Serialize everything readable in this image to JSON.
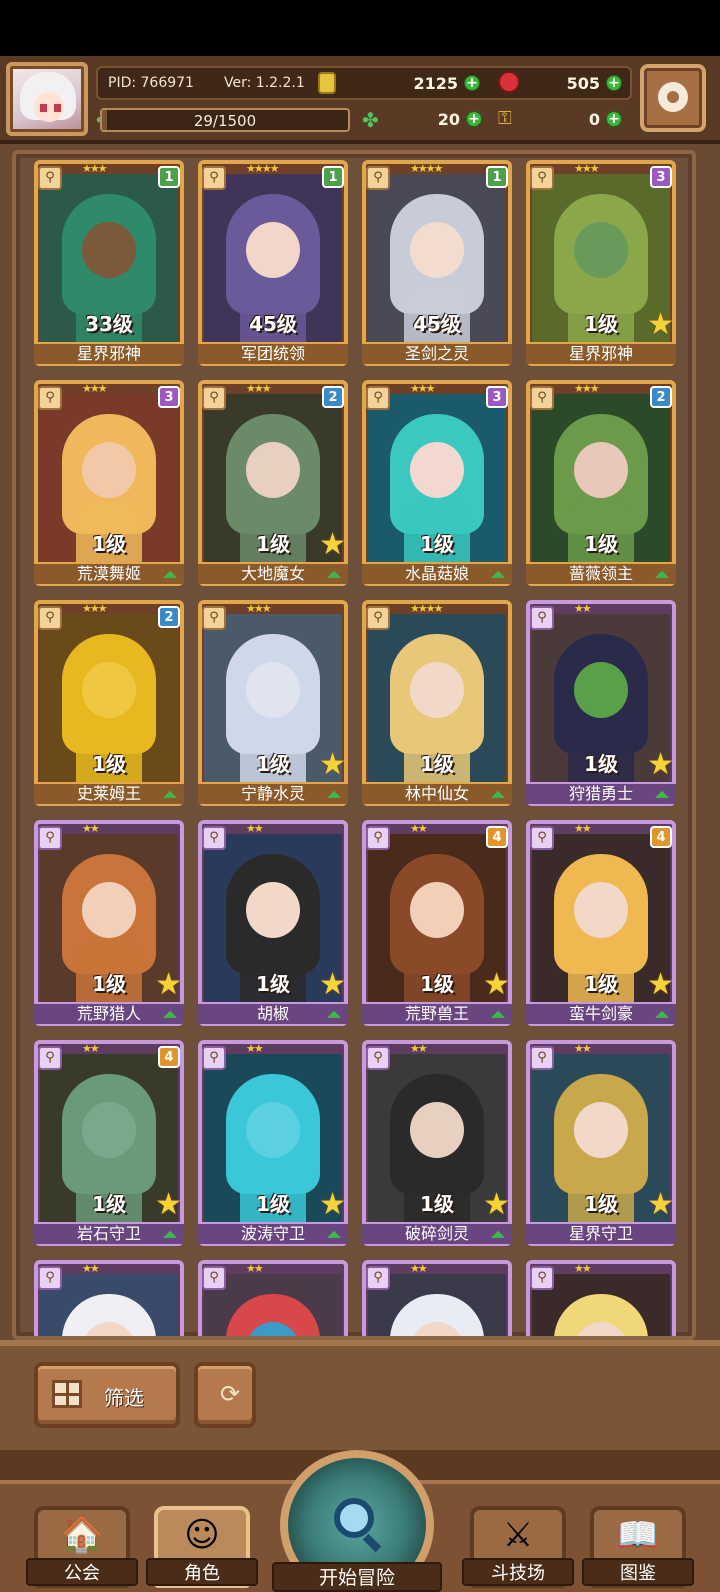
{
  "header": {
    "pid": "PID: 766971",
    "version": "Ver: 1.2.2.1",
    "gold": "2125",
    "gems": "505",
    "exp_text": "29/1500",
    "exp_fraction": 0.0193,
    "clover": "20",
    "keys": "0"
  },
  "cards": [
    {
      "name": "星界邪神",
      "level": "33级",
      "stars": "★★★",
      "badge": "1",
      "badge_color": "#4ca04a",
      "frame": "gold",
      "bg": "#2c5a4a",
      "hue": "#2f8a6a",
      "skin": "#7a5a3a",
      "tag_star": false
    },
    {
      "name": "军团统领",
      "level": "45级",
      "stars": "★★★★",
      "badge": "1",
      "badge_color": "#4ca04a",
      "frame": "gold",
      "bg": "#403458",
      "hue": "#6a5a9a",
      "skin": "#f2d6ca",
      "tag_star": false
    },
    {
      "name": "圣剑之灵",
      "level": "45级",
      "stars": "★★★★",
      "badge": "1",
      "badge_color": "#4ca04a",
      "frame": "gold",
      "bg": "#4a4a56",
      "hue": "#c8ccd8",
      "skin": "#f2dccf",
      "tag_star": false
    },
    {
      "name": "星界邪神",
      "level": "1级",
      "stars": "★★★",
      "badge": "3",
      "badge_color": "#9a5ac2",
      "frame": "gold",
      "bg": "#5a6a2a",
      "hue": "#8aa84a",
      "skin": "#6a9a5a",
      "tag_star": true
    },
    {
      "name": "荒漠舞姬",
      "level": "1级",
      "stars": "★★★",
      "badge": "3",
      "badge_color": "#9a5ac2",
      "frame": "gold",
      "bg": "#7a3a2a",
      "hue": "#f0b85a",
      "skin": "#f2c8a8",
      "tag_star": false,
      "up": true
    },
    {
      "name": "大地魔女",
      "level": "1级",
      "stars": "★★★",
      "badge": "2",
      "badge_color": "#3a8ac8",
      "frame": "gold",
      "bg": "#3a3a2a",
      "hue": "#6a8a6a",
      "skin": "#e8d0c0",
      "tag_star": true,
      "up": true
    },
    {
      "name": "水晶菇娘",
      "level": "1级",
      "stars": "★★★",
      "badge": "3",
      "badge_color": "#9a5ac2",
      "frame": "gold",
      "bg": "#1a5a6a",
      "hue": "#3ac8c0",
      "skin": "#f2d8cf",
      "tag_star": false,
      "up": true
    },
    {
      "name": "蔷薇领主",
      "level": "1级",
      "stars": "★★★",
      "badge": "2",
      "badge_color": "#3a8ac8",
      "frame": "gold",
      "bg": "#2a4a2a",
      "hue": "#6a9a4a",
      "skin": "#e8c8b8",
      "tag_star": false,
      "up": true
    },
    {
      "name": "史莱姆王",
      "level": "1级",
      "stars": "★★★",
      "badge": "2",
      "badge_color": "#3a8ac8",
      "frame": "gold",
      "bg": "#6a4a1a",
      "hue": "#e8b820",
      "skin": "#f0c840",
      "tag_star": false,
      "up": true
    },
    {
      "name": "宁静水灵",
      "level": "1级",
      "stars": "★★★",
      "badge": "",
      "badge_color": "",
      "frame": "gold",
      "bg": "#4a5a6a",
      "hue": "#cfd8e8",
      "skin": "#dfe4ef",
      "tag_star": true,
      "up": true
    },
    {
      "name": "林中仙女",
      "level": "1级",
      "stars": "★★★★",
      "badge": "",
      "badge_color": "",
      "frame": "gold",
      "bg": "#2a4a5a",
      "hue": "#e8c878",
      "skin": "#f2d8c8",
      "tag_star": false,
      "up": true
    },
    {
      "name": "狩猎勇士",
      "level": "1级",
      "stars": "★★",
      "badge": "",
      "badge_color": "",
      "frame": "purple",
      "bg": "#4a3a3a",
      "hue": "#2a2a4a",
      "skin": "#5aa048",
      "tag_star": true,
      "up": true
    },
    {
      "name": "荒野猎人",
      "level": "1级",
      "stars": "★★",
      "badge": "",
      "badge_color": "",
      "frame": "purple",
      "bg": "#5a3a2a",
      "hue": "#c8743a",
      "skin": "#f2d0b8",
      "tag_star": true,
      "up": true
    },
    {
      "name": "胡椒",
      "level": "1级",
      "stars": "★★",
      "badge": "",
      "badge_color": "",
      "frame": "purple",
      "bg": "#2a3a5a",
      "hue": "#2a2a2a",
      "skin": "#f2d8c8",
      "tag_star": true,
      "up": true
    },
    {
      "name": "荒野兽王",
      "level": "1级",
      "stars": "★★",
      "badge": "4",
      "badge_color": "#e0962a",
      "frame": "purple",
      "bg": "#4a2a1a",
      "hue": "#8a4a2a",
      "skin": "#f2d0b8",
      "tag_star": true,
      "up": true
    },
    {
      "name": "蛮牛剑豪",
      "level": "1级",
      "stars": "★★",
      "badge": "4",
      "badge_color": "#e0962a",
      "frame": "purple",
      "bg": "#3a2a2a",
      "hue": "#f0b850",
      "skin": "#f2d8c8",
      "tag_star": true,
      "up": true
    },
    {
      "name": "岩石守卫",
      "level": "1级",
      "stars": "★★",
      "badge": "4",
      "badge_color": "#e0962a",
      "frame": "purple",
      "bg": "#3a3a2a",
      "hue": "#6a9a7a",
      "skin": "#7aa88a",
      "tag_star": true,
      "up": true
    },
    {
      "name": "波涛守卫",
      "level": "1级",
      "stars": "★★",
      "badge": "",
      "badge_color": "",
      "frame": "purple",
      "bg": "#1a4a5a",
      "hue": "#3ac8d8",
      "skin": "#5ad0e0",
      "tag_star": true,
      "up": true
    },
    {
      "name": "破碎剑灵",
      "level": "1级",
      "stars": "★★",
      "badge": "",
      "badge_color": "",
      "frame": "purple",
      "bg": "#3a3a3a",
      "hue": "#2a2a2a",
      "skin": "#e8d0c0",
      "tag_star": true,
      "up": true
    },
    {
      "name": "星界守卫",
      "level": "1级",
      "stars": "★★",
      "badge": "",
      "badge_color": "",
      "frame": "purple",
      "bg": "#2a4a5a",
      "hue": "#c8a84a",
      "skin": "#f2d8c8",
      "tag_star": true,
      "up": false
    },
    {
      "name": "",
      "level": "",
      "stars": "★★",
      "badge": "",
      "badge_color": "",
      "frame": "purple",
      "bg": "#3a4a6a",
      "hue": "#f0f0f4",
      "skin": "#f2d8c8",
      "tag_star": false
    },
    {
      "name": "",
      "level": "",
      "stars": "★★",
      "badge": "",
      "badge_color": "",
      "frame": "purple",
      "bg": "#4a3a4a",
      "hue": "#d8484a",
      "skin": "#3a9ac8",
      "tag_star": false
    },
    {
      "name": "",
      "level": "",
      "stars": "★★",
      "badge": "",
      "badge_color": "",
      "frame": "purple",
      "bg": "#3a3a4a",
      "hue": "#e8ecf4",
      "skin": "#f2d8c8",
      "tag_star": false
    },
    {
      "name": "",
      "level": "",
      "stars": "★★",
      "badge": "",
      "badge_color": "",
      "frame": "purple",
      "bg": "#3a2a2a",
      "hue": "#f0d878",
      "skin": "#f2d8c8",
      "tag_star": false
    }
  ],
  "controls": {
    "filter_label": "筛选"
  },
  "nav": {
    "guild": "公会",
    "characters": "角色",
    "adventure": "开始冒险",
    "arena": "斗技场",
    "codex": "图鉴"
  }
}
